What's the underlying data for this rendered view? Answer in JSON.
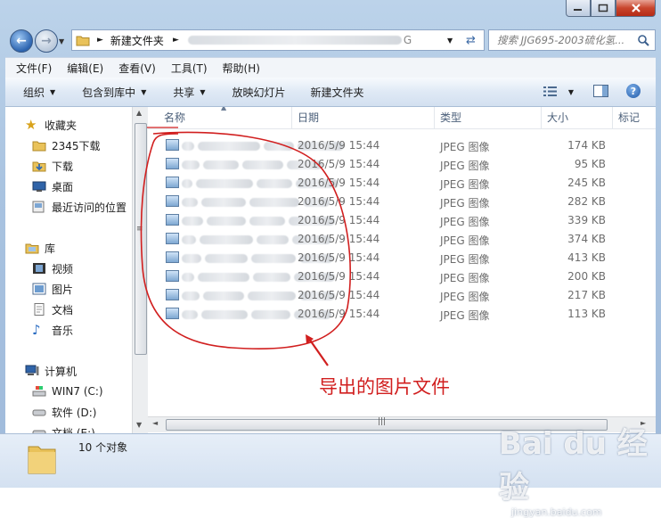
{
  "window": {
    "path_root": "新建文件夹",
    "path_tail": "G"
  },
  "search": {
    "placeholder": "搜索 JJG695-2003硫化氢..."
  },
  "menu": [
    "文件(F)",
    "编辑(E)",
    "查看(V)",
    "工具(T)",
    "帮助(H)"
  ],
  "toolbar": {
    "organize": "组织",
    "include": "包含到库中",
    "share": "共享",
    "slideshow": "放映幻灯片",
    "new_folder": "新建文件夹"
  },
  "sidebar": {
    "favorites": "收藏夹",
    "fav_items": [
      "2345下载",
      "下载",
      "桌面",
      "最近访问的位置"
    ],
    "libraries": "库",
    "lib_items": [
      "视频",
      "图片",
      "文档",
      "音乐"
    ],
    "computer": "计算机",
    "drives": [
      "WIN7 (C:)",
      "软件 (D:)",
      "文档 (E:)"
    ]
  },
  "columns": [
    "名称",
    "日期",
    "类型",
    "大小",
    "标记"
  ],
  "files": [
    {
      "date": "2016/5/9 15:44",
      "type": "JPEG 图像",
      "size": "174 KB"
    },
    {
      "date": "2016/5/9 15:44",
      "type": "JPEG 图像",
      "size": "95 KB"
    },
    {
      "date": "2016/5/9 15:44",
      "type": "JPEG 图像",
      "size": "245 KB"
    },
    {
      "date": "2016/5/9 15:44",
      "type": "JPEG 图像",
      "size": "282 KB"
    },
    {
      "date": "2016/5/9 15:44",
      "type": "JPEG 图像",
      "size": "339 KB"
    },
    {
      "date": "2016/5/9 15:44",
      "type": "JPEG 图像",
      "size": "374 KB"
    },
    {
      "date": "2016/5/9 15:44",
      "type": "JPEG 图像",
      "size": "413 KB"
    },
    {
      "date": "2016/5/9 15:44",
      "type": "JPEG 图像",
      "size": "200 KB"
    },
    {
      "date": "2016/5/9 15:44",
      "type": "JPEG 图像",
      "size": "217 KB"
    },
    {
      "date": "2016/5/9 15:44",
      "type": "JPEG 图像",
      "size": "113 KB"
    }
  ],
  "status": {
    "count": "10 个对象"
  },
  "annotation": {
    "text": "导出的图片文件",
    "color": "#d11f1f"
  },
  "watermark": {
    "logo": "Bai du 经验",
    "url": "jingyan.baidu.com"
  }
}
